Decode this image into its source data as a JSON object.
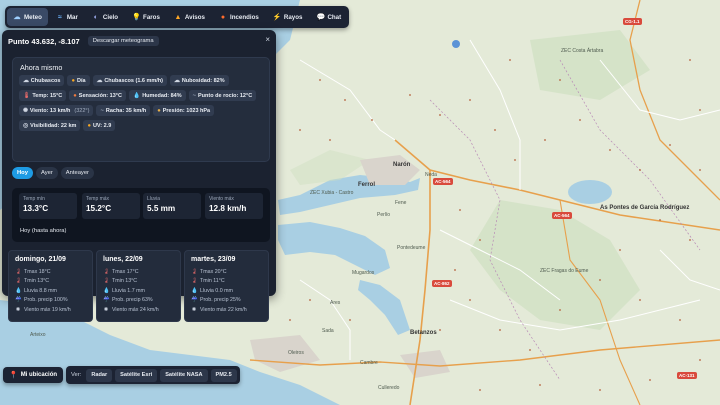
{
  "nav": {
    "items": [
      {
        "icon": "☁",
        "label": "Meteo",
        "active": true
      },
      {
        "icon": "≈",
        "label": "Mar",
        "active": false
      },
      {
        "icon": "◐",
        "label": "Cielo",
        "active": false
      },
      {
        "icon": "💡",
        "label": "Faros",
        "active": false
      },
      {
        "icon": "▲",
        "label": "Avisos",
        "active": false
      },
      {
        "icon": "●",
        "label": "Incendios",
        "active": false
      },
      {
        "icon": "⚡",
        "label": "Rayos",
        "active": false
      },
      {
        "icon": "💬",
        "label": "Chat",
        "active": false
      }
    ]
  },
  "panel": {
    "title": "Punto 43.632, -8.107",
    "meteogram_label": "Descargar meteograma",
    "close": "×",
    "now": {
      "title": "Ahora mismo",
      "chips": [
        {
          "icon": "☁",
          "text": "Chubascos",
          "sub": "",
          "color": "#cfd6e2"
        },
        {
          "icon": "●",
          "text": "Día",
          "sub": "",
          "color": "#f5a623"
        },
        {
          "icon": "☁",
          "text": "Chubascos (1.6 mm/h)",
          "sub": "",
          "color": "#cfd6e2"
        },
        {
          "icon": "☁",
          "text": "Nubosidad: 82%",
          "sub": "",
          "color": "#cfd6e2"
        },
        {
          "icon": "🌡",
          "text": "Temp: 15°C",
          "sub": "",
          "color": "#e86a6a"
        },
        {
          "icon": "●",
          "text": "Sensación: 13°C",
          "sub": "",
          "color": "#f07b3f"
        },
        {
          "icon": "💧",
          "text": "Humedad: 84%",
          "sub": "",
          "color": "#5aa9ff"
        },
        {
          "icon": "~",
          "text": "Punto de rocío: 12°C",
          "sub": "",
          "color": "#9aa6b8"
        },
        {
          "icon": "✺",
          "text": "Viento: 13 km/h",
          "sub": "(322°)",
          "color": "#cfd6e2"
        },
        {
          "icon": "~",
          "text": "Racha: 35 km/h",
          "sub": "",
          "color": "#9aa6b8"
        },
        {
          "icon": "●",
          "text": "Presión: 1023 hPa",
          "sub": "",
          "color": "#e8b04a"
        },
        {
          "icon": "◎",
          "text": "Visibilidad: 22 km",
          "sub": "",
          "color": "#cfd6e2"
        },
        {
          "icon": "●",
          "text": "UV: 2.9",
          "sub": "",
          "color": "#f5a623"
        }
      ]
    },
    "tabs": [
      {
        "label": "Hoy",
        "active": true
      },
      {
        "label": "Ayer",
        "active": false
      },
      {
        "label": "Anteayer",
        "active": false
      }
    ],
    "today": {
      "stats": [
        {
          "label": "Temp mín",
          "value": "13.3°C"
        },
        {
          "label": "Temp máx",
          "value": "15.2°C"
        },
        {
          "label": "Lluvia",
          "value": "5.5 mm"
        },
        {
          "label": "Viento máx",
          "value": "12.8 km/h"
        }
      ],
      "note": "Hoy (hasta ahora)"
    },
    "forecast": [
      {
        "title": "domingo, 21/09",
        "rows": [
          {
            "icon": "🌡",
            "text": "Tmax 18°C",
            "color": "#e86a6a"
          },
          {
            "icon": "🌡",
            "text": "Tmin 13°C",
            "color": "#e86a6a"
          },
          {
            "icon": "💧",
            "text": "Lluvia 8.8 mm",
            "color": "#5aa9ff"
          },
          {
            "icon": "☔",
            "text": "Prob. precip 100%",
            "color": "#7d8fff"
          },
          {
            "icon": "✺",
            "text": "Viento máx 19 km/h",
            "color": "#cfd6e2"
          }
        ]
      },
      {
        "title": "lunes, 22/09",
        "rows": [
          {
            "icon": "🌡",
            "text": "Tmax 17°C",
            "color": "#e86a6a"
          },
          {
            "icon": "🌡",
            "text": "Tmin 13°C",
            "color": "#e86a6a"
          },
          {
            "icon": "💧",
            "text": "Lluvia 1.7 mm",
            "color": "#5aa9ff"
          },
          {
            "icon": "☔",
            "text": "Prob. precip 63%",
            "color": "#7d8fff"
          },
          {
            "icon": "✺",
            "text": "Viento máx 24 km/h",
            "color": "#cfd6e2"
          }
        ]
      },
      {
        "title": "martes, 23/09",
        "rows": [
          {
            "icon": "🌡",
            "text": "Tmax 20°C",
            "color": "#e86a6a"
          },
          {
            "icon": "🌡",
            "text": "Tmin 11°C",
            "color": "#e86a6a"
          },
          {
            "icon": "💧",
            "text": "Lluvia 0.0 mm",
            "color": "#5aa9ff"
          },
          {
            "icon": "☔",
            "text": "Prob. precip 25%",
            "color": "#7d8fff"
          },
          {
            "icon": "✺",
            "text": "Viento máx 22 km/h",
            "color": "#cfd6e2"
          }
        ]
      }
    ]
  },
  "map": {
    "labels": [
      "ZEC Costa Ártabra",
      "Narón",
      "Ferrol",
      "Neda",
      "Fene",
      "Perlío",
      "Pontedeume",
      "As Pontes de García Rodríguez",
      "ZEC Xubia - Castro",
      "ZEC Fragas do Eume",
      "Betanzos",
      "Sada",
      "Oleiros",
      "Cambre",
      "Culleredo",
      "Arteixo",
      "Ares",
      "Mugardos"
    ],
    "shields": [
      "CG-1.1",
      "AC-564",
      "AC-564",
      "AC-862",
      "AC-131"
    ]
  },
  "bottom": {
    "location_label": "Mi ubicación",
    "layers_label": "Ver:",
    "layers": [
      "Radar",
      "Satélite Esri",
      "Satélite NASA",
      "PM2.5"
    ]
  }
}
